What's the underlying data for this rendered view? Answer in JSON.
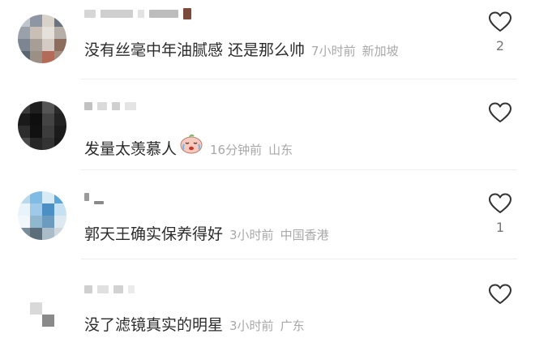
{
  "comments": [
    {
      "text": "没有丝毫中年油腻感 还是那么帅",
      "time": "7小时前",
      "location": "新加坡",
      "likes": "2",
      "icon": "heart-outline-icon",
      "avatar_palette": [
        "#bfc5cc",
        "#8e96a3",
        "#d9d2cb",
        "#6a7380",
        "#9aa1ab",
        "#c9bfb4",
        "#e6e0da",
        "#b7b0a8",
        "#7d8591",
        "#a79f97",
        "#d4ccc4",
        "#8d6d5e",
        "#5c6470",
        "#9c8f85",
        "#b46a58",
        "#a28c7e"
      ]
    },
    {
      "text": "发量太羡慕人",
      "time": "16分钟前",
      "location": "山东",
      "likes": "",
      "icon": "heart-outline-icon",
      "emoji": "crying-baby-emoji",
      "avatar_palette": [
        "#3a3a3a",
        "#1e1e1e",
        "#555555",
        "#2a2a2a",
        "#1a1a1a",
        "#0f0f0f",
        "#444444",
        "#222222",
        "#2d2d2d",
        "#111111",
        "#3c3c3c",
        "#1b1b1b",
        "#4a4a4a",
        "#262626",
        "#333333",
        "#181818"
      ]
    },
    {
      "text": "郭天王确实保养得好",
      "time": "3小时前",
      "location": "中国香港",
      "likes": "1",
      "icon": "heart-outline-icon",
      "avatar_palette": [
        "#b9d9ee",
        "#7fbbe3",
        "#d7ebf6",
        "#5aa6d8",
        "#e8f3fa",
        "#9ec9e8",
        "#4c8fc4",
        "#c6e1f2",
        "#f1f7fb",
        "#8fb8cf",
        "#6b9cc0",
        "#dce9f1",
        "#7a8c99",
        "#5d6e7b",
        "#a9bcc8",
        "#cfd8de"
      ]
    },
    {
      "text": "没了滤镜真实的明星",
      "time": "3小时前",
      "location": "广东",
      "likes": "",
      "icon": "heart-outline-icon",
      "avatar_palette": [
        "#ffffff",
        "#ffffff",
        "#ffffff",
        "#ffffff",
        "#ffffff",
        "#d9d9d9",
        "#ffffff",
        "#ffffff",
        "#ffffff",
        "#ffffff",
        "#8a8a8a",
        "#ffffff",
        "#ffffff",
        "#ffffff",
        "#ffffff",
        "#ffffff"
      ]
    }
  ]
}
